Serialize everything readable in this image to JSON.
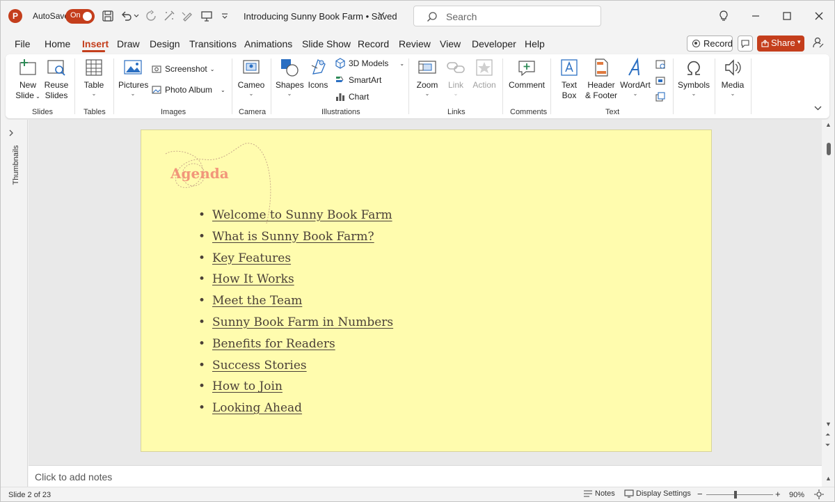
{
  "titlebar": {
    "app_logo": "P",
    "autosave_label": "AutoSave",
    "autosave_state": "On",
    "document_title": "Introducing Sunny Book Farm • Saved",
    "search_placeholder": "Search",
    "accent_color": "#c43e1c"
  },
  "menu": {
    "items": [
      "File",
      "Home",
      "Insert",
      "Draw",
      "Design",
      "Transitions",
      "Animations",
      "Slide Show",
      "Record",
      "Review",
      "View",
      "Developer",
      "Help"
    ],
    "active": "Insert",
    "record_label": "Record",
    "share_label": "Share"
  },
  "ribbon": {
    "slides": {
      "new_slide": "New",
      "new_slide_2": "Slide",
      "reuse": "Reuse",
      "reuse_2": "Slides",
      "label": "Slides"
    },
    "tables": {
      "table": "Table",
      "label": "Tables"
    },
    "images": {
      "pictures": "Pictures",
      "screenshot": "Screenshot",
      "photo_album": "Photo Album",
      "label": "Images"
    },
    "camera": {
      "cameo": "Cameo",
      "label": "Camera"
    },
    "illustrations": {
      "shapes": "Shapes",
      "icons": "Icons",
      "models": "3D Models",
      "smartart": "SmartArt",
      "chart": "Chart",
      "label": "Illustrations"
    },
    "links": {
      "zoom": "Zoom",
      "link": "Link",
      "action": "Action",
      "label": "Links"
    },
    "comments": {
      "comment": "Comment",
      "label": "Comments"
    },
    "text": {
      "textbox": "Text",
      "textbox_2": "Box",
      "header": "Header",
      "header_2": "& Footer",
      "wordart": "WordArt",
      "label": "Text"
    },
    "symbols": {
      "symbols": "Symbols"
    },
    "media": {
      "media": "Media"
    }
  },
  "thumbnails_label": "Thumbnails",
  "slide": {
    "background_color": "#fffcae",
    "title": "Agenda",
    "items": [
      "Welcome to Sunny Book Farm",
      "What is Sunny Book Farm?",
      "Key Features",
      "How It Works",
      "Meet the Team",
      "Sunny Book Farm in Numbers",
      "Benefits for Readers",
      "Success Stories",
      "How to Join",
      "Looking Ahead"
    ]
  },
  "notes": {
    "placeholder": "Click to add notes"
  },
  "status": {
    "slide_counter": "Slide 2 of 23",
    "notes_label": "Notes",
    "display_settings": "Display Settings",
    "zoom_level": "90%"
  }
}
